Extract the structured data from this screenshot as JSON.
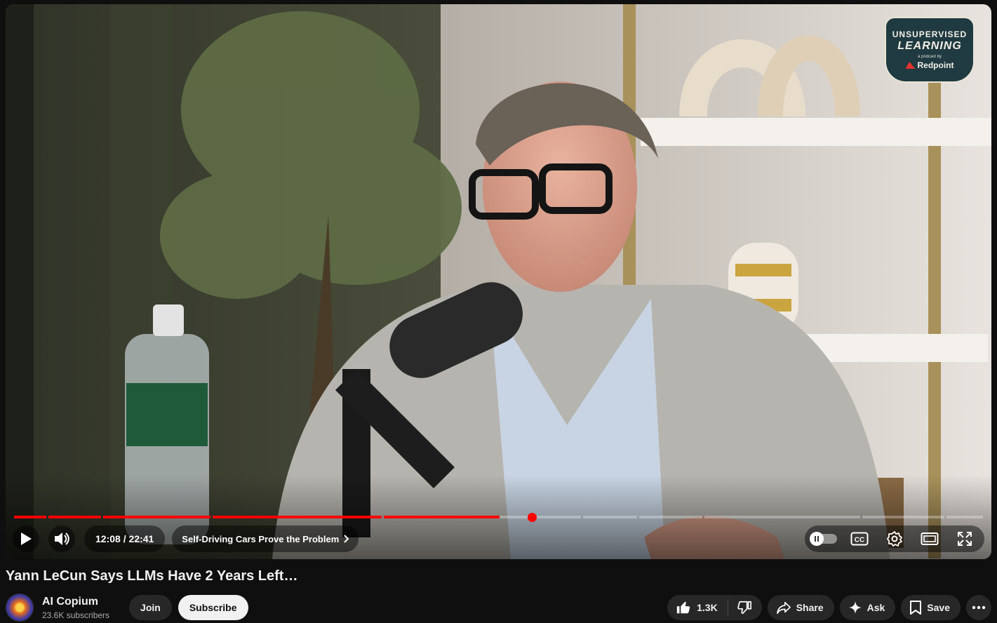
{
  "player": {
    "badge": {
      "line1": "UNSUPERVISED",
      "line2": "LEARNING",
      "line3": "a podcast by",
      "line4": "Redpoint"
    },
    "current_time": "12:08",
    "duration": "22:41",
    "time_display": "12:08 / 22:41",
    "chapter_title": "Self-Driving Cars Prove the Problem",
    "progress_fraction": 0.533,
    "accent_color": "#ff0000"
  },
  "video": {
    "title": "Yann LeCun Says LLMs Have 2 Years Left…"
  },
  "channel": {
    "name": "AI Copium",
    "subscribers": "23.6K subscribers",
    "join_label": "Join",
    "subscribe_label": "Subscribe"
  },
  "actions": {
    "like_count": "1.3K",
    "share_label": "Share",
    "ask_label": "Ask",
    "save_label": "Save"
  },
  "icons": {
    "play": "play-icon",
    "volume": "volume-icon",
    "chevron": "chevron-right-icon",
    "autoplay": "autoplay-toggle-icon",
    "captions": "captions-icon",
    "settings": "gear-icon",
    "theater": "theater-mode-icon",
    "fullscreen": "fullscreen-icon",
    "like": "thumbs-up-icon",
    "dislike": "thumbs-down-icon",
    "share": "share-arrow-icon",
    "ask": "sparkle-icon",
    "save": "bookmark-icon",
    "more": "more-horizontal-icon"
  }
}
